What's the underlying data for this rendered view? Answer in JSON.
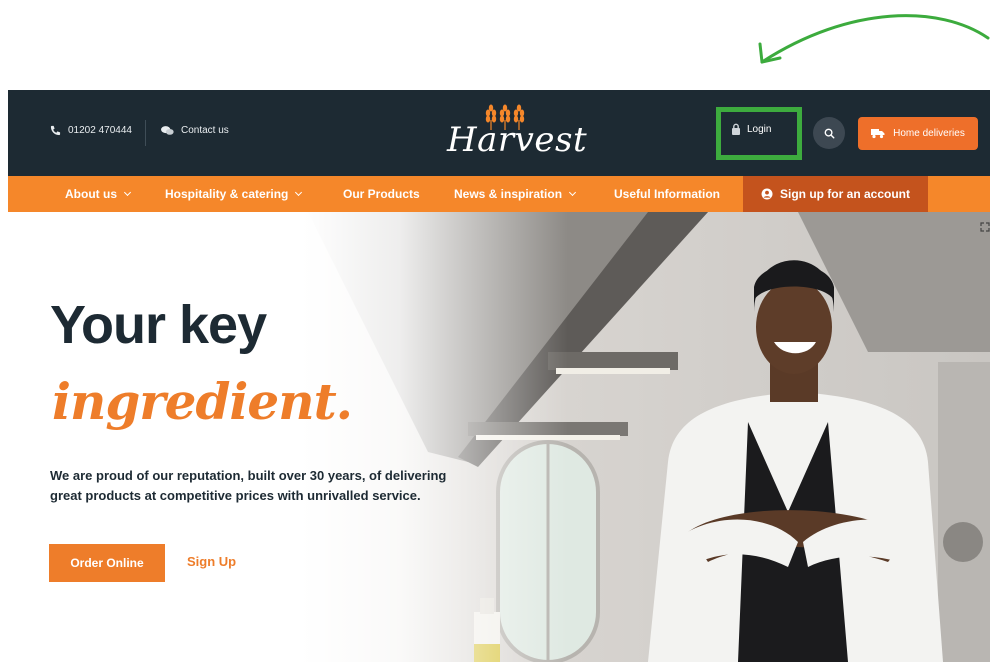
{
  "header": {
    "phone": "01202 470444",
    "contact_label": "Contact us",
    "logo_text": "Harvest",
    "login_label": "Login",
    "home_deliveries_label": "Home deliveries"
  },
  "nav": {
    "items": [
      {
        "label": "About us",
        "dropdown": true
      },
      {
        "label": "Hospitality & catering",
        "dropdown": true
      },
      {
        "label": "Our Products",
        "dropdown": false
      },
      {
        "label": "News & inspiration",
        "dropdown": true
      },
      {
        "label": "Useful Information",
        "dropdown": false
      }
    ],
    "account_label": "Sign up for an account"
  },
  "hero": {
    "headline": "Your key",
    "script_headline": "ingredient.",
    "description": "We are proud of our reputation, built over 30 years, of delivering great products at competitive prices with unrivalled service.",
    "order_button": "Order Online",
    "signup_link": "Sign Up"
  },
  "colors": {
    "dark_navy": "#1d2a33",
    "orange": "#f5872a",
    "burnt_orange": "#c4531d",
    "highlight_green": "#3dab3e"
  },
  "icons": [
    "phone-icon",
    "chat-icon",
    "wheat-icon",
    "lock-icon",
    "search-icon",
    "truck-icon",
    "user-icon",
    "chevron-down-icon",
    "expand-icon"
  ]
}
